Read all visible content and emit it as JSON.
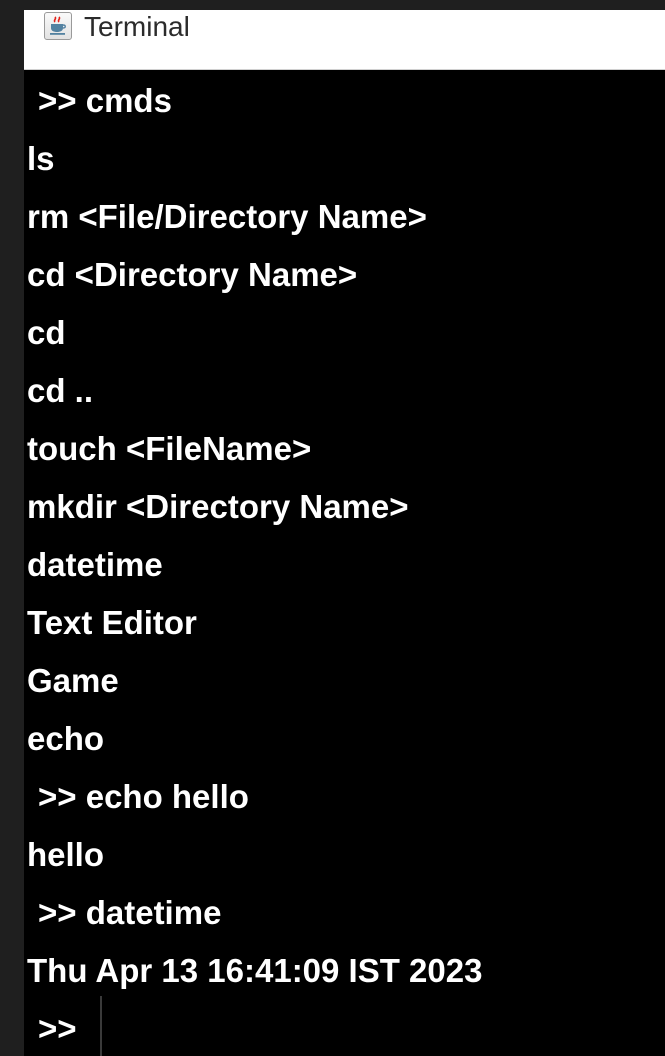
{
  "window": {
    "title": "Terminal",
    "icon": "java-cup-icon"
  },
  "console": {
    "lines": [
      " >> cmds",
      "ls",
      "rm <File/Directory Name>",
      "cd <Directory Name>",
      "cd",
      "cd ..",
      "touch <FileName>",
      "mkdir <Directory Name>",
      "datetime",
      "Text Editor",
      "Game",
      "echo",
      " >> echo hello",
      "hello",
      " >> datetime",
      "Thu Apr 13 16:41:09 IST 2023",
      " >>"
    ]
  },
  "colors": {
    "console_background": "#000000",
    "console_text": "#ffffff",
    "titlebar_background": "#ffffff"
  }
}
